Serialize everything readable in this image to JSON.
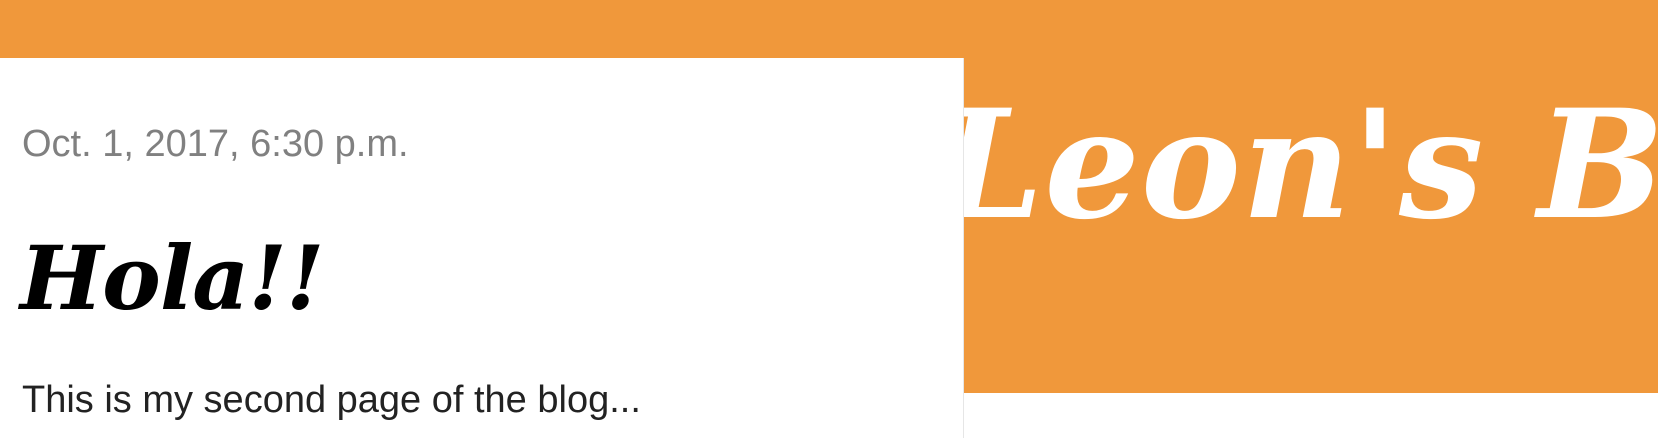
{
  "post": {
    "date": "Oct. 1, 2017, 6:30 p.m.",
    "title": "Hola!!",
    "body": "This is my second page of the blog..."
  },
  "banner": {
    "title": "Leon's Blog"
  },
  "colors": {
    "accent": "#f0983b",
    "background": "#ffffff",
    "date_text": "#808080",
    "title_text": "#000000",
    "body_text": "#222222"
  }
}
